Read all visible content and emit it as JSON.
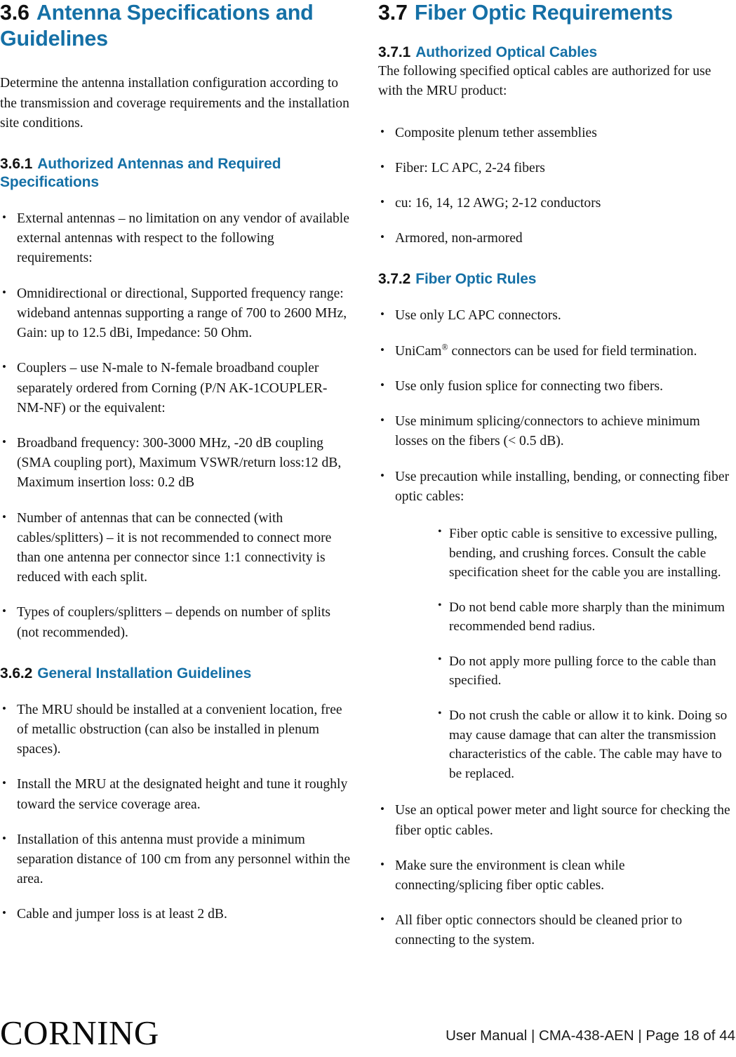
{
  "document": {
    "brand": "CORNING",
    "footer_meta": "User Manual | CMA-438-AEN | Page 18 of 44",
    "accent_color": "#1570A6",
    "body_color": "#141414"
  },
  "left_column": {
    "section": {
      "number": "3.6",
      "title": "Antenna Specifications and Guidelines"
    },
    "intro": "Determine the antenna installation configuration according to the transmission and coverage requirements and the installation site conditions.",
    "subsection_1": {
      "number": "3.6.1",
      "title": "Authorized Antennas and Required Specifications",
      "bullets": [
        "External antennas – no limitation on any vendor of available external antennas with respect to the following requirements:",
        "Omnidirectional or directional, Supported frequency range: wideband antennas supporting a range of 700 to 2600 MHz, Gain: up to 12.5 dBi, Impedance: 50 Ohm.",
        "Couplers – use N-male to N-female broadband coupler separately ordered from Corning (P/N AK-1COUPLER-NM-NF) or the equivalent:",
        "Broadband frequency: 300-3000 MHz, -20 dB coupling (SMA coupling port), Maximum VSWR/return loss:12 dB, Maximum insertion loss: 0.2 dB",
        "Number of antennas that can be connected (with cables/splitters) – it is not recommended to connect more than one antenna per connector since 1:1 connectivity is reduced with each split.",
        "Types of couplers/splitters – depends on number of splits (not recommended)."
      ]
    },
    "subsection_2": {
      "number": "3.6.2",
      "title": "General Installation Guidelines",
      "bullets": [
        "The MRU should be installed at a convenient location, free of metallic obstruction (can also be installed in plenum spaces).",
        "Install the MRU at the designated height and tune it roughly toward the service coverage area.",
        "Installation of this antenna must provide a minimum separation distance of 100 cm from any personnel within the area.",
        "Cable and jumper loss is at least 2 dB."
      ]
    }
  },
  "right_column": {
    "section": {
      "number": "3.7",
      "title": "Fiber Optic Requirements"
    },
    "subsection_1": {
      "number": "3.7.1",
      "title": "Authorized Optical Cables",
      "intro": "The following specified optical cables are authorized for use with the MRU product:",
      "bullets": [
        "Composite plenum tether assemblies",
        "Fiber: LC APC, 2-24 fibers",
        "cu: 16, 14, 12 AWG; 2-12 conductors",
        "Armored, non-armored"
      ]
    },
    "subsection_2": {
      "number": "3.7.2",
      "title": "Fiber Optic Rules",
      "bullets_before": [
        "Use only LC APC connectors.",
        "Use only fusion splice for connecting two fibers.",
        "Use minimum splicing/connectors to achieve minimum losses on the fibers (< 0.5 dB).",
        "Use precaution while installing, bending, or connecting fiber optic cables:"
      ],
      "unicam_bullet": {
        "prefix": "UniCam",
        "mark": "®",
        "suffix": " connectors can be used for field termination."
      },
      "nested_bullets": [
        "Fiber optic cable is sensitive to excessive pulling, bending, and crushing forces. Consult the cable specification sheet for the cable you are installing.",
        "Do not bend cable more sharply than the minimum recommended bend radius.",
        "Do not apply more pulling force to the cable than specified.",
        "Do not crush the cable or allow it to kink. Doing so may cause damage that can alter the transmission characteristics of the cable. The cable may have to be replaced."
      ],
      "bullets_after": [
        "Use an optical power meter and light source for checking the fiber optic cables.",
        "Make sure the environment is clean while connecting/splicing fiber optic cables.",
        "All fiber optic connectors should be cleaned prior to connecting to the system."
      ]
    }
  }
}
